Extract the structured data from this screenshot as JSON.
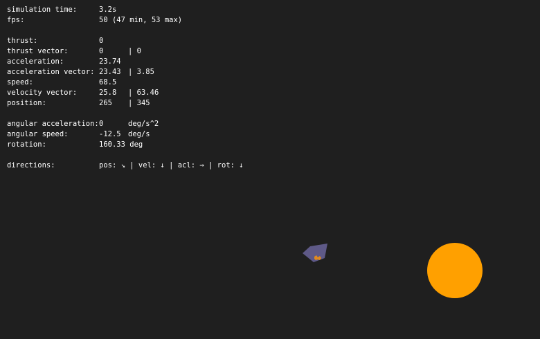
{
  "hud": {
    "simulation_time": {
      "label": "simulation time:",
      "value": "3.2s"
    },
    "fps": {
      "label": "fps:",
      "value": "50 (47 min, 53 max)"
    },
    "thrust": {
      "label": "thrust:",
      "value": "0"
    },
    "thrust_vector": {
      "label": "thrust vector:",
      "x": "0",
      "y": "0"
    },
    "acceleration": {
      "label": "acceleration:",
      "value": "23.74"
    },
    "acceleration_vector": {
      "label": "acceleration vector:",
      "x": "23.43",
      "y": "3.85"
    },
    "speed": {
      "label": "speed:",
      "value": "68.5"
    },
    "velocity_vector": {
      "label": "velocity vector:",
      "x": "25.8",
      "y": "63.46"
    },
    "position": {
      "label": "position:",
      "x": "265",
      "y": "345"
    },
    "angular_acceleration": {
      "label": "angular acceleration:",
      "value": "0",
      "unit": "deg/s^2"
    },
    "angular_speed": {
      "label": "angular speed:",
      "value": "-12.5",
      "unit": "deg/s"
    },
    "rotation": {
      "label": "rotation:",
      "value": "160.33 deg"
    },
    "directions": {
      "label": "directions:",
      "value": "pos: ↘ | vel: ↓ | acl: → | rot: ↓"
    }
  },
  "scene": {
    "background_color": "#1f1f1f",
    "ship_color": "#5e5987",
    "flame_color": "#e08a1e",
    "sun_color": "#ffa000"
  }
}
